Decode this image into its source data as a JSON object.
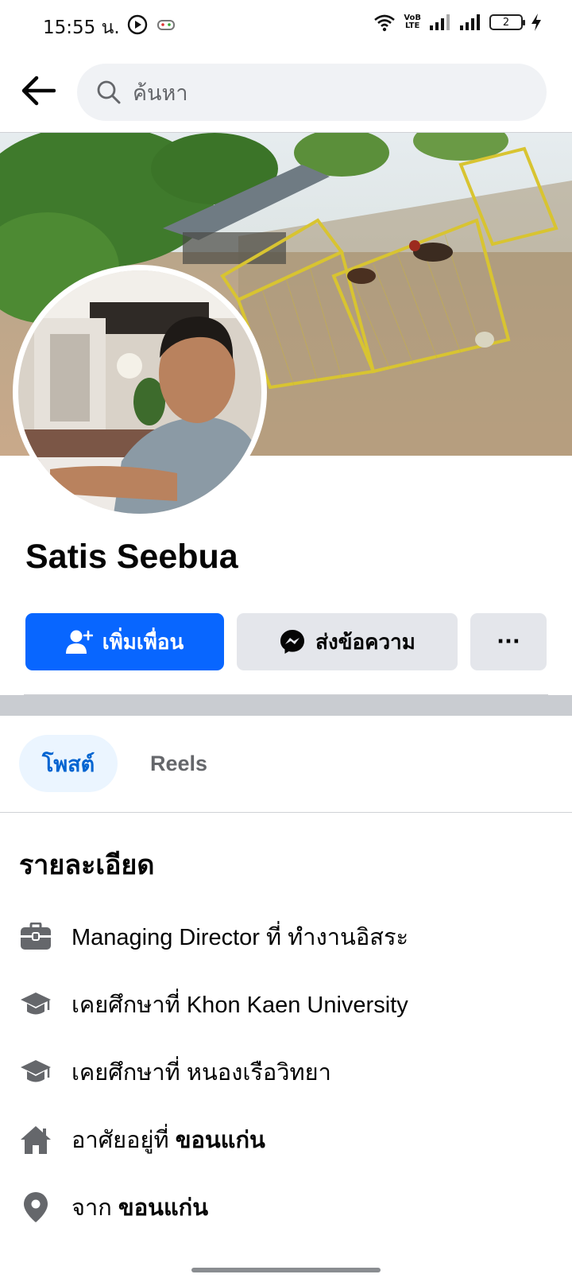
{
  "status_bar": {
    "time": "15:55 น.",
    "network_badge_top": "VoB",
    "network_badge_bottom": "LTE",
    "battery_level": "2"
  },
  "search": {
    "placeholder": "ค้นหา"
  },
  "profile": {
    "name": "Satis Seebua"
  },
  "actions": {
    "add_friend_label": "เพิ่มเพื่อน",
    "message_label": "ส่งข้อความ",
    "more_label": "···"
  },
  "tabs": [
    {
      "label": "โพสต์",
      "active": true
    },
    {
      "label": "Reels",
      "active": false
    }
  ],
  "details": {
    "title": "รายละเอียด",
    "items": [
      {
        "icon": "briefcase-icon",
        "text": "Managing Director ที่ ทำงานอิสระ",
        "bold": ""
      },
      {
        "icon": "graduation-cap-icon",
        "text": "เคยศึกษาที่ Khon Kaen University",
        "bold": ""
      },
      {
        "icon": "graduation-cap-icon",
        "text": "เคยศึกษาที่ หนองเรือวิทยา",
        "bold": ""
      },
      {
        "icon": "home-icon",
        "text": "อาศัยอยู่ที่ ",
        "bold": "ขอนแก่น"
      },
      {
        "icon": "location-pin-icon",
        "text": "จาก ",
        "bold": "ขอนแก่น"
      }
    ]
  },
  "colors": {
    "brand_blue": "#0866ff",
    "tab_active_bg": "#ebf5ff",
    "tab_active_text": "#0064d1",
    "secondary_button": "#e4e6eb",
    "icon_gray": "#65676b"
  }
}
